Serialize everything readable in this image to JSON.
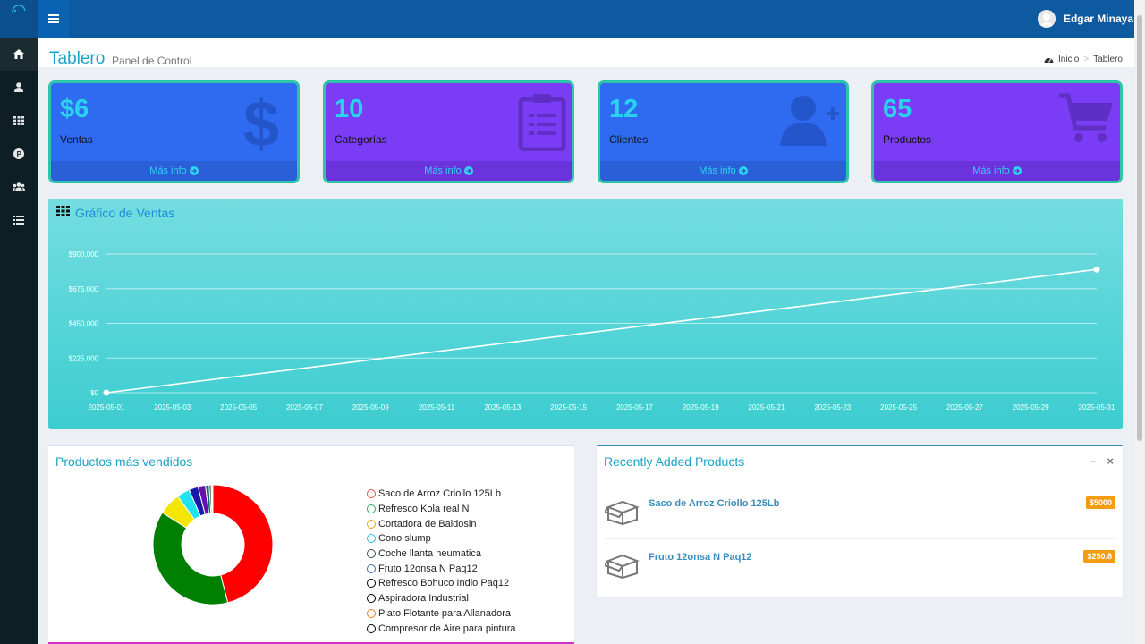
{
  "user": {
    "name": "Edgar Minaya"
  },
  "page": {
    "title": "Tablero",
    "subtitle": "Panel de Control"
  },
  "breadcrumb": {
    "home": "Inicio",
    "current": "Tablero"
  },
  "cards": [
    {
      "value": "$6",
      "label": "Ventas",
      "link": "Más info",
      "icon": "dollar-icon",
      "color": "#2f6bf0"
    },
    {
      "value": "10",
      "label": "Categorías",
      "link": "Más info",
      "icon": "clipboard-icon",
      "color": "#7a3df5"
    },
    {
      "value": "12",
      "label": "Clientes",
      "link": "Más info",
      "icon": "user-plus-icon",
      "color": "#2f6bf0"
    },
    {
      "value": "65",
      "label": "Productos",
      "link": "Más info",
      "icon": "cart-icon",
      "color": "#7a3df5"
    }
  ],
  "sales_chart": {
    "title": "Gráfico de Ventas"
  },
  "chart_data": [
    {
      "type": "line",
      "title": "Gráfico de Ventas",
      "x_ticks": [
        "2025-05-01",
        "2025-05-03",
        "2025-05-05",
        "2025-05-07",
        "2025-05-09",
        "2025-05-11",
        "2025-05-13",
        "2025-05-15",
        "2025-05-17",
        "2025-05-19",
        "2025-05-21",
        "2025-05-23",
        "2025-05-25",
        "2025-05-27",
        "2025-05-29",
        "2025-05-31"
      ],
      "y_ticks": [
        "$0",
        "$225,000",
        "$450,000",
        "$675,000",
        "$900,000"
      ],
      "ylim": [
        0,
        900000
      ],
      "xlim": [
        "2025-05-01",
        "2025-05-31"
      ],
      "series": [
        {
          "x": [
            "2025-05-01",
            "2025-05-31"
          ],
          "y": [
            0,
            800000
          ]
        }
      ],
      "grid": true
    },
    {
      "type": "pie",
      "title": "Productos más vendidos",
      "labels": [
        "Saco de Arroz Criollo 125Lb",
        "Refresco Kola real N",
        "Cortadora de Baldosin",
        "Cono slump",
        "Coche llanta neumatica",
        "Fruto 12onsa N Paq12",
        "Refresco Bohuco Indio Paq12",
        "Aspiradora Industrial",
        "Plato Flotante para Allanadora",
        "Compresor de Aire para pintura"
      ],
      "values": [
        46,
        38,
        6,
        3.5,
        2.5,
        2,
        1,
        0.5,
        0.3,
        0.2
      ],
      "colors": [
        "#ff0000",
        "#008000",
        "#f5e600",
        "#1fe3f0",
        "#1a1aa8",
        "#6a0dad",
        "#0a6e5c",
        "#222222",
        "#e67e22",
        "#111111"
      ],
      "legend_colors": [
        "#e74c3c",
        "#27ae60",
        "#f39c12",
        "#2ab7d8",
        "#34495e",
        "#3a6ea5",
        "#000000",
        "#000000",
        "#e67e22",
        "#000000"
      ]
    }
  ],
  "top_products": {
    "title": "Productos más vendidos"
  },
  "recent": {
    "title": "Recently Added Products",
    "items": [
      {
        "name": "Saco de Arroz Criollo 125Lb",
        "price": "$5000"
      },
      {
        "name": "Fruto 12onsa N Paq12",
        "price": "$250.8"
      }
    ]
  }
}
